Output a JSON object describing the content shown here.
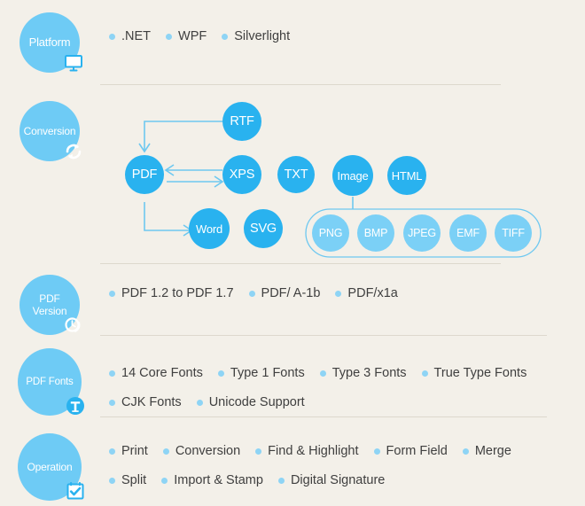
{
  "colors": {
    "background": "#f3f0e9",
    "badge_blue": "#6ecbf5",
    "node_blue": "#29b2ef",
    "node_light_blue": "#7bd0f6",
    "bullet_dot": "#8ed4f5",
    "text": "#3f3f3f",
    "divider": "#ddd8cd",
    "line": "#6ec8f0"
  },
  "sections": [
    {
      "id": "platform",
      "badge_label": "Platform",
      "badge_icon": "monitor-icon",
      "items": [
        ".NET",
        "WPF",
        "Silverlight"
      ]
    },
    {
      "id": "conversion",
      "badge_label": "Conversion",
      "badge_icon": "refresh-cycle-icon",
      "items": []
    },
    {
      "id": "pdf-version",
      "badge_label": "PDF\nVersion",
      "badge_icon": "clock-history-icon",
      "items": [
        "PDF 1.2 to PDF 1.7",
        "PDF/ A-1b",
        "PDF/x1a"
      ]
    },
    {
      "id": "pdf-fonts",
      "badge_label": "PDF Fonts",
      "badge_icon": "text-t-icon",
      "items": [
        "14 Core Fonts",
        "Type 1 Fonts",
        "Type 3 Fonts",
        "True Type Fonts",
        "CJK Fonts",
        "Unicode Support"
      ]
    },
    {
      "id": "operation",
      "badge_label": "Operation",
      "badge_icon": "checklist-icon",
      "items": [
        "Print",
        "Conversion",
        "Find & Highlight",
        "Form Field",
        "Merge",
        "Split",
        "Import & Stamp",
        "Digital Signature"
      ]
    }
  ],
  "conversion_diagram": {
    "nodes": {
      "rtf": "RTF",
      "pdf": "PDF",
      "xps": "XPS",
      "txt": "TXT",
      "image": "Image",
      "html": "HTML",
      "word": "Word",
      "svg": "SVG",
      "png": "PNG",
      "bmp": "BMP",
      "jpeg": "JPEG",
      "emf": "EMF",
      "tiff": "TIFF"
    }
  }
}
